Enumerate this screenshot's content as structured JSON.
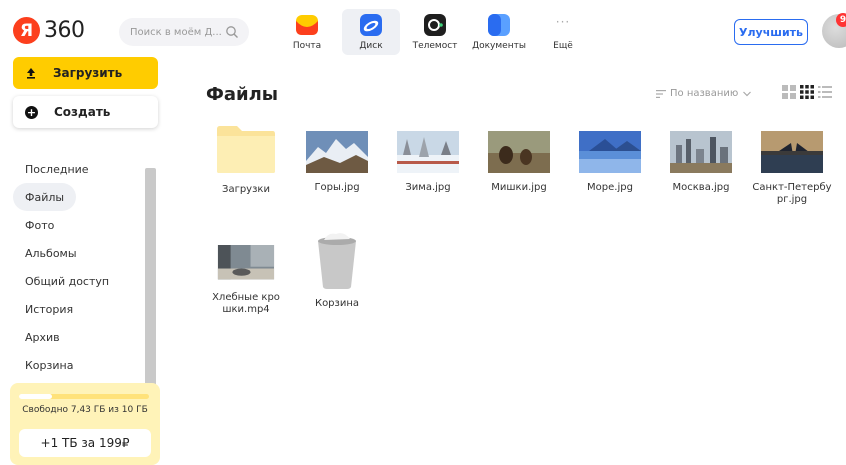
{
  "header": {
    "logo_letter": "Я",
    "logo_text": "360",
    "search_placeholder": "Поиск в моём Д...",
    "services": [
      {
        "label": "Почта",
        "icon": "mail-icon",
        "color": "#ffcc00"
      },
      {
        "label": "Диск",
        "icon": "disk-icon",
        "color": "#2a6cf0",
        "active": true
      },
      {
        "label": "Телемост",
        "icon": "telemost-icon",
        "color": "#222222"
      },
      {
        "label": "Документы",
        "icon": "documents-icon",
        "color": "#3b82f6"
      },
      {
        "label": "Ещё",
        "icon": "more-icon"
      }
    ],
    "upgrade_label": "Улучшить",
    "notification_count": "9"
  },
  "sidebar": {
    "upload_label": "Загрузить",
    "create_label": "Создать",
    "nav": [
      {
        "label": "Последние"
      },
      {
        "label": "Файлы",
        "active": true
      },
      {
        "label": "Фото"
      },
      {
        "label": "Альбомы"
      },
      {
        "label": "Общий доступ"
      },
      {
        "label": "История"
      },
      {
        "label": "Архив"
      },
      {
        "label": "Корзина"
      }
    ],
    "storage_text": "Свободно 7,43 ГБ из 10 ГБ",
    "storage_button": "+1 ТБ за 199₽",
    "storage_used_fraction": 0.257
  },
  "main": {
    "title": "Файлы",
    "sort_label": "По названию",
    "files": [
      {
        "name": "Загрузки",
        "type": "folder"
      },
      {
        "name": "Горы.jpg",
        "type": "image",
        "theme": "mountains"
      },
      {
        "name": "Зима.jpg",
        "type": "image",
        "theme": "winter"
      },
      {
        "name": "Мишки.jpg",
        "type": "image",
        "theme": "bears"
      },
      {
        "name": "Море.jpg",
        "type": "image",
        "theme": "sea"
      },
      {
        "name": "Москва.jpg",
        "type": "image",
        "theme": "moscow"
      },
      {
        "name": "Санкт-Петербург.jpg",
        "type": "image",
        "theme": "spb"
      },
      {
        "name": "Хлебные крошки.mp4",
        "type": "video",
        "theme": "video"
      },
      {
        "name": "Корзина",
        "type": "trash"
      }
    ]
  },
  "colors": {
    "accent_yellow": "#ffcc00",
    "accent_blue": "#2a6cf0",
    "logo_red": "#fc3f1d"
  }
}
